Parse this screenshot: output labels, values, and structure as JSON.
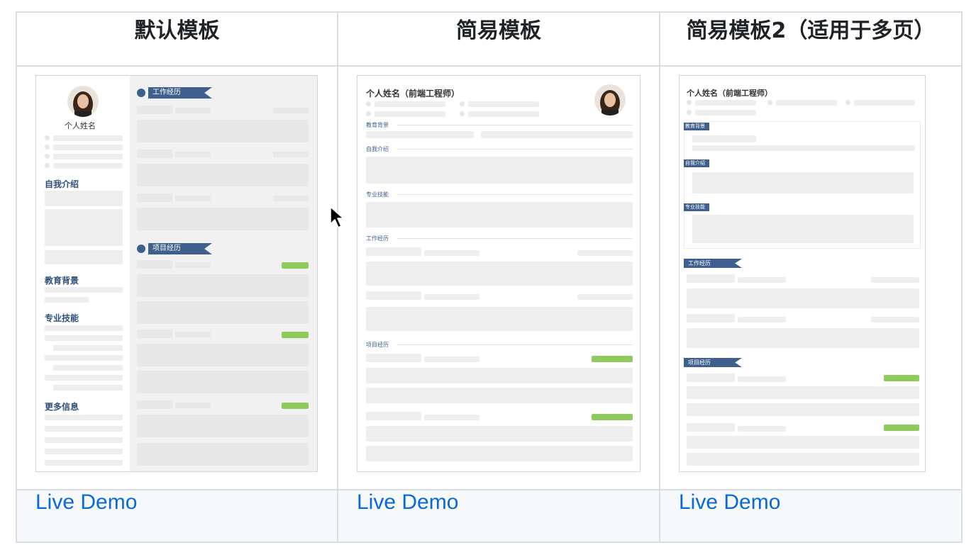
{
  "columns": [
    {
      "title": "默认模板",
      "link": "Live Demo",
      "preview": {
        "name": "个人姓名",
        "sections": [
          "自我介绍",
          "教育背景",
          "专业技能",
          "更多信息"
        ],
        "ribbons": [
          "工作经历",
          "项目经历"
        ]
      }
    },
    {
      "title": "简易模板",
      "link": "Live Demo",
      "preview": {
        "name": "个人姓名（前端工程师）",
        "sections": [
          "教育背景",
          "自我介绍",
          "专业技能",
          "工作经历",
          "项目经历"
        ]
      }
    },
    {
      "title": "简易模板2（适用于多页）",
      "link": "Live Demo",
      "preview": {
        "name": "个人姓名（前端工程师）",
        "tags": [
          "教育背景",
          "自我介绍",
          "专业技能"
        ],
        "ribbons": [
          "工作经历",
          "项目经历"
        ]
      }
    }
  ],
  "colors": {
    "link": "#0969da",
    "ribbon": "#3f5f8f",
    "accent_green": "#8fca5c"
  }
}
